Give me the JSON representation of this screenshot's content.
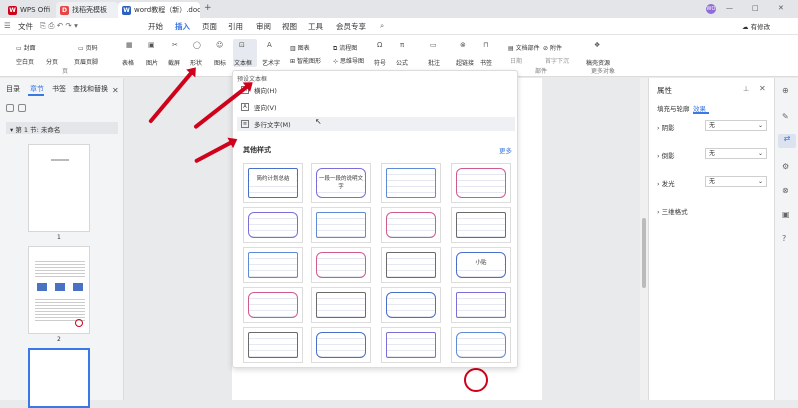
{
  "titlebar": {
    "tabs": [
      {
        "label": "WPS Office",
        "icon": "wps-logo-icon"
      },
      {
        "label": "找稻壳模板",
        "icon": "daoke-icon"
      },
      {
        "label": "word教程（新）.docx",
        "icon": "word-doc-icon"
      }
    ],
    "add_tab": "+",
    "user_initial": "WO",
    "window_controls": [
      "—",
      "□",
      "✕"
    ]
  },
  "menubar": {
    "file": "文件",
    "tabs": [
      "开始",
      "插入",
      "页面",
      "引用",
      "审阅",
      "视图",
      "工具",
      "会员专享"
    ],
    "active_tab": "插入",
    "share": "分享",
    "cloud": "有修改"
  },
  "ribbon": {
    "group1": [
      "封面",
      "页码",
      "空白页",
      "分页",
      "页眉页脚"
    ],
    "group2": [
      "表格",
      "图片",
      "截屏",
      "形状",
      "图标"
    ],
    "group3": [
      "文本框",
      "艺术字",
      "图表",
      "流程图",
      "智能图形",
      "思维导图"
    ],
    "group4": [
      "符号",
      "公式"
    ],
    "group5": [
      "批注",
      "超链接",
      "书签"
    ],
    "group6": [
      "文档部件",
      "附件",
      "日期",
      "首字下沉"
    ],
    "group7": [
      "稿壳资源"
    ],
    "group_labels": {
      "page": "页",
      "parts": "部件",
      "more": "更多对象"
    }
  },
  "leftpanel": {
    "tabs": [
      "目录",
      "章节",
      "书签",
      "查找和替换"
    ],
    "active_tab": "章节",
    "section_label": "第 1 节: 未命名",
    "page_numbers": [
      "1",
      "2"
    ]
  },
  "dropdown": {
    "preset_title": "预设文本框",
    "options": [
      {
        "label": "横向(H)",
        "icon": "horizontal-textbox-icon"
      },
      {
        "label": "竖向(V)",
        "icon": "vertical-textbox-icon"
      },
      {
        "label": "多行文字(M)",
        "icon": "multiline-textbox-icon"
      }
    ],
    "other_styles_title": "其他样式",
    "more_link": "更多",
    "templates": [
      [
        "简约计划总结",
        "一段一段的说明文字",
        "",
        ""
      ],
      [
        "",
        "",
        "",
        ""
      ],
      [
        "",
        "",
        "",
        "小贴"
      ],
      [
        "",
        "",
        "",
        ""
      ],
      [
        "",
        "",
        "",
        ""
      ]
    ]
  },
  "rightpanel": {
    "title": "属性",
    "tabs": [
      "填充与轮廓",
      "效果"
    ],
    "active_tab": "效果",
    "effects": [
      {
        "label": "阴影",
        "value": "无"
      },
      {
        "label": "倒影",
        "value": "无"
      },
      {
        "label": "发光",
        "value": "无"
      },
      {
        "label": "三维格式",
        "value": ""
      }
    ]
  },
  "colors": {
    "accent": "#3b78e7",
    "arrow": "#d0021b",
    "titlebar": "#e3e5e8",
    "word_blue": "#2b5fc0"
  }
}
